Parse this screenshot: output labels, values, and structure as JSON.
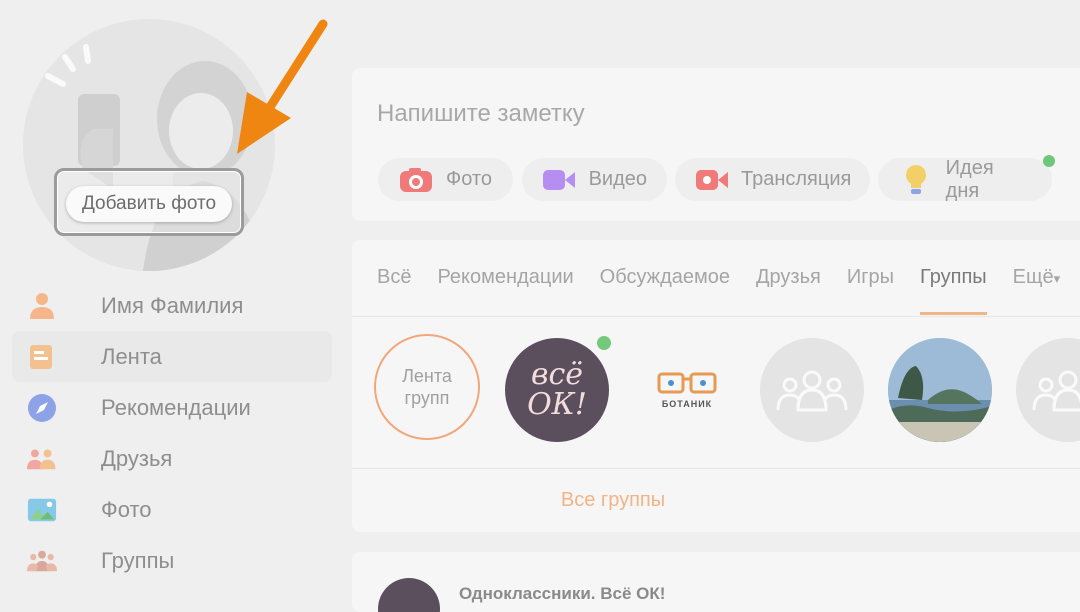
{
  "avatar": {
    "add_photo_label": "Добавить фото"
  },
  "sidebar": {
    "items": [
      {
        "label": "Имя Фамилия",
        "icon": "user-icon",
        "color": "#f5b78a"
      },
      {
        "label": "Лента",
        "icon": "feed-icon",
        "color": "#f3c08f"
      },
      {
        "label": "Рекомендации",
        "icon": "compass-icon",
        "color": "#8ea2e8"
      },
      {
        "label": "Друзья",
        "icon": "friends-icon",
        "color": "#f0a7a0"
      },
      {
        "label": "Фото",
        "icon": "photo-icon",
        "color": "#86c8e8"
      },
      {
        "label": "Группы",
        "icon": "groups-icon",
        "color": "#d9a89a"
      }
    ]
  },
  "note": {
    "placeholder": "Напишите заметку",
    "buttons": [
      {
        "label": "Фото",
        "icon": "camera-icon",
        "color": "#f07a7a"
      },
      {
        "label": "Видео",
        "icon": "video-icon",
        "color": "#b68df0"
      },
      {
        "label": "Трансляция",
        "icon": "broadcast-icon",
        "color": "#f07a7a"
      },
      {
        "label": "Идея дня",
        "icon": "lightbulb-icon",
        "color": "#f3cf68"
      }
    ]
  },
  "feed": {
    "tabs": [
      "Всё",
      "Рекомендации",
      "Обсуждаемое",
      "Друзья",
      "Игры",
      "Группы",
      "Ещё"
    ],
    "active_tab": "Группы",
    "lenta_label_1": "Лента",
    "lenta_label_2": "групп",
    "group_vsyo_text_1": "всё",
    "group_vsyo_text_2": "ОК!",
    "group_botanik_text": "БОТАНИК",
    "all_groups": "Все группы",
    "accent": "#f1b486"
  },
  "post": {
    "author": "Одноклассники. Всё ОК!"
  },
  "colors": {
    "arrow": "#ef8612",
    "background": "#efefef",
    "card": "#f6f6f6"
  }
}
